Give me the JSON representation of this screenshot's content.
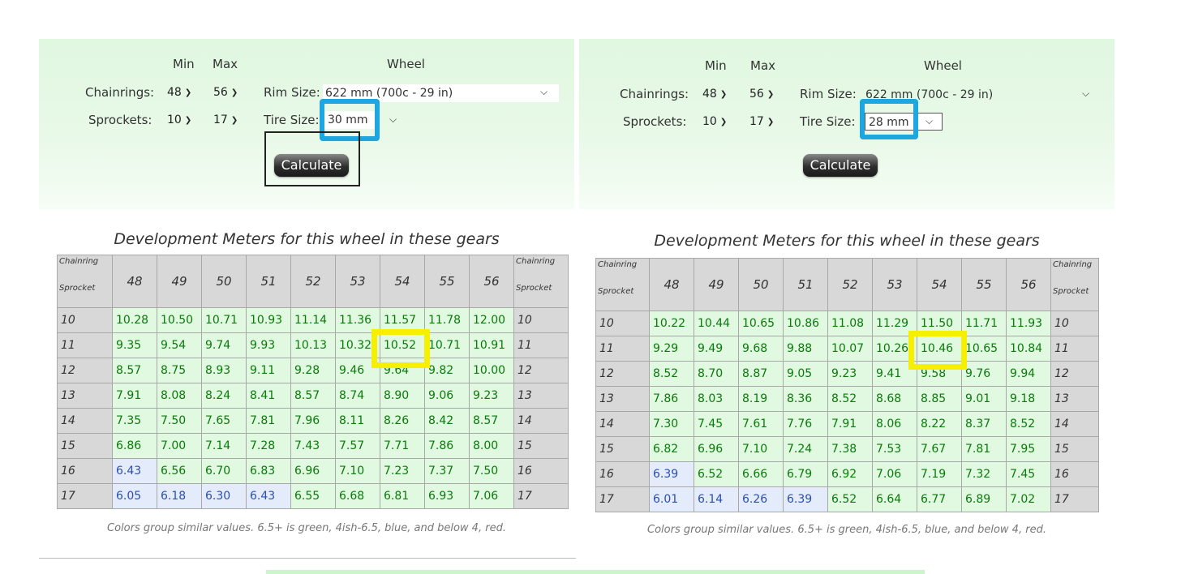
{
  "labels": {
    "min": "Min",
    "max": "Max",
    "wheel": "Wheel",
    "chainrings": "Chainrings:",
    "sprockets": "Sprockets:",
    "rim_size": "Rim Size:",
    "tire_size": "Tire Size:",
    "calculate": "Calculate",
    "table_title": "Development Meters for this wheel in these gears",
    "corner_top": "Chainring",
    "corner_bottom": "Sprocket",
    "note": "Colors group similar values. 6.5+ is green, 4ish-6.5, blue, and below 4, red."
  },
  "left": {
    "chainring_min": "48",
    "chainring_max": "56",
    "sprocket_min": "10",
    "sprocket_max": "17",
    "rim_size": "622 mm (700c - 29 in)",
    "tire_size": "30 mm",
    "chainrings": [
      "48",
      "49",
      "50",
      "51",
      "52",
      "53",
      "54",
      "55",
      "56"
    ],
    "rows": [
      {
        "sprocket": "10",
        "values": [
          "10.28",
          "10.50",
          "10.71",
          "10.93",
          "11.14",
          "11.36",
          "11.57",
          "11.78",
          "12.00"
        ]
      },
      {
        "sprocket": "11",
        "values": [
          "9.35",
          "9.54",
          "9.74",
          "9.93",
          "10.13",
          "10.32",
          "10.52",
          "10.71",
          "10.91"
        ]
      },
      {
        "sprocket": "12",
        "values": [
          "8.57",
          "8.75",
          "8.93",
          "9.11",
          "9.28",
          "9.46",
          "9.64",
          "9.82",
          "10.00"
        ]
      },
      {
        "sprocket": "13",
        "values": [
          "7.91",
          "8.08",
          "8.24",
          "8.41",
          "8.57",
          "8.74",
          "8.90",
          "9.06",
          "9.23"
        ]
      },
      {
        "sprocket": "14",
        "values": [
          "7.35",
          "7.50",
          "7.65",
          "7.81",
          "7.96",
          "8.11",
          "8.26",
          "8.42",
          "8.57"
        ]
      },
      {
        "sprocket": "15",
        "values": [
          "6.86",
          "7.00",
          "7.14",
          "7.28",
          "7.43",
          "7.57",
          "7.71",
          "7.86",
          "8.00"
        ]
      },
      {
        "sprocket": "16",
        "values": [
          "6.43",
          "6.56",
          "6.70",
          "6.83",
          "6.96",
          "7.10",
          "7.23",
          "7.37",
          "7.50"
        ]
      },
      {
        "sprocket": "17",
        "values": [
          "6.05",
          "6.18",
          "6.30",
          "6.43",
          "6.55",
          "6.68",
          "6.81",
          "6.93",
          "7.06"
        ]
      }
    ]
  },
  "right": {
    "chainring_min": "48",
    "chainring_max": "56",
    "sprocket_min": "10",
    "sprocket_max": "17",
    "rim_size": "622 mm (700c - 29 in)",
    "tire_size": "28 mm",
    "chainrings": [
      "48",
      "49",
      "50",
      "51",
      "52",
      "53",
      "54",
      "55",
      "56"
    ],
    "rows": [
      {
        "sprocket": "10",
        "values": [
          "10.22",
          "10.44",
          "10.65",
          "10.86",
          "11.08",
          "11.29",
          "11.50",
          "11.71",
          "11.93"
        ]
      },
      {
        "sprocket": "11",
        "values": [
          "9.29",
          "9.49",
          "9.68",
          "9.88",
          "10.07",
          "10.26",
          "10.46",
          "10.65",
          "10.84"
        ]
      },
      {
        "sprocket": "12",
        "values": [
          "8.52",
          "8.70",
          "8.87",
          "9.05",
          "9.23",
          "9.41",
          "9.58",
          "9.76",
          "9.94"
        ]
      },
      {
        "sprocket": "13",
        "values": [
          "7.86",
          "8.03",
          "8.19",
          "8.36",
          "8.52",
          "8.68",
          "8.85",
          "9.01",
          "9.18"
        ]
      },
      {
        "sprocket": "14",
        "values": [
          "7.30",
          "7.45",
          "7.61",
          "7.76",
          "7.91",
          "8.06",
          "8.22",
          "8.37",
          "8.52"
        ]
      },
      {
        "sprocket": "15",
        "values": [
          "6.82",
          "6.96",
          "7.10",
          "7.24",
          "7.38",
          "7.53",
          "7.67",
          "7.81",
          "7.95"
        ]
      },
      {
        "sprocket": "16",
        "values": [
          "6.39",
          "6.52",
          "6.66",
          "6.79",
          "6.92",
          "7.06",
          "7.19",
          "7.32",
          "7.45"
        ]
      },
      {
        "sprocket": "17",
        "values": [
          "6.01",
          "6.14",
          "6.26",
          "6.39",
          "6.52",
          "6.64",
          "6.77",
          "6.89",
          "7.02"
        ]
      }
    ]
  },
  "colors": {
    "green_bg": "#e0f9e0",
    "green_text": "#0a7a0a",
    "blue_bg": "#e4ecfb",
    "blue_text": "#2a4fb0",
    "highlight_blue": "#1ea6e0",
    "highlight_yellow": "#f6f000"
  },
  "highlights": {
    "blue_box": "tire-size-select",
    "yellow_box": "development-cell 11 x 54"
  }
}
